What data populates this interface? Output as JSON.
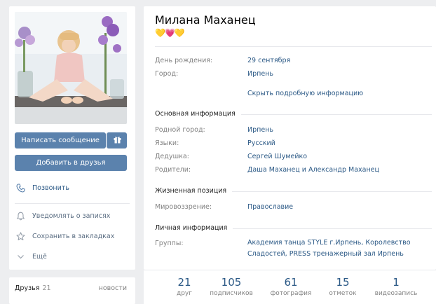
{
  "profile": {
    "name": "Милана Маханец",
    "emoji": "💛💗💛"
  },
  "actions": {
    "write_message": "Написать сообщение",
    "add_friend": "Добавить в друзья",
    "call": "Позвонить",
    "notify": "Уведомлять о записях",
    "bookmark": "Сохранить в закладках",
    "more": "Ещё"
  },
  "friends": {
    "label": "Друзья",
    "count": "21",
    "updates": "новости"
  },
  "info": {
    "birthday_label": "День рождения:",
    "birthday": "29 сентября",
    "city_label": "Город:",
    "city": "Ирпень",
    "hide_details": "Скрыть подробную информацию",
    "basic_section": "Основная информация",
    "hometown_label": "Родной город:",
    "hometown": "Ирпень",
    "languages_label": "Языки:",
    "languages": "Русский",
    "grandfather_label": "Дедушка:",
    "grandfather": "Сергей Шумейко",
    "parents_label": "Родители:",
    "parents": "Даша Маханец и Александр Маханец",
    "life_section": "Жизненная позиция",
    "worldview_label": "Мировоззрение:",
    "worldview": "Православие",
    "personal_section": "Личная информация",
    "groups_label": "Группы:",
    "groups_line1": "Академия танца STYLE г.Ирпень, Королевство",
    "groups_line2": "Сладостей, PRESS тренажерный зал Ирпень"
  },
  "counters": [
    {
      "n": "21",
      "t": "друг"
    },
    {
      "n": "105",
      "t": "подписчиков"
    },
    {
      "n": "61",
      "t": "фотография"
    },
    {
      "n": "15",
      "t": "отметок"
    },
    {
      "n": "1",
      "t": "видеозапись"
    }
  ],
  "colors": {
    "accent": "#5b82ad",
    "link": "#2a5885",
    "muted": "#828282",
    "background": "#edeef0"
  }
}
